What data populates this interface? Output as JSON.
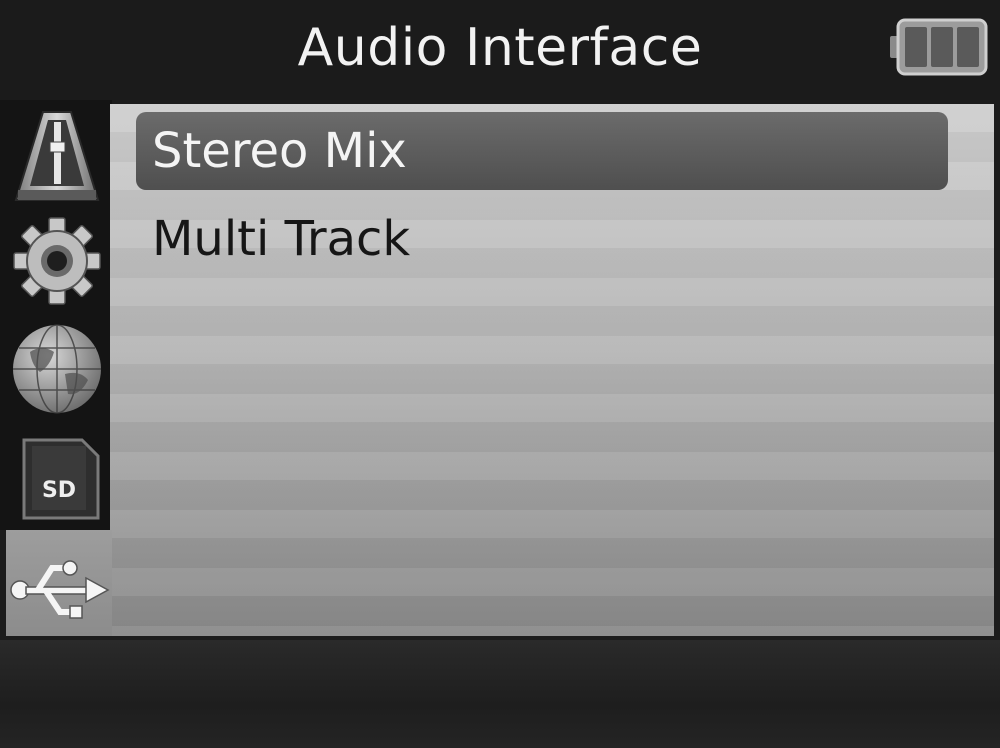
{
  "header": {
    "title": "Audio Interface",
    "battery_icon": "battery-full-icon"
  },
  "sidebar": {
    "items": [
      {
        "icon": "metronome-icon",
        "name": "metronome"
      },
      {
        "icon": "gear-icon",
        "name": "settings"
      },
      {
        "icon": "globe-icon",
        "name": "language"
      },
      {
        "icon": "sd-card-icon",
        "name": "sd-card",
        "label": "SD"
      },
      {
        "icon": "usb-icon",
        "name": "usb",
        "selected": true
      }
    ]
  },
  "menu": {
    "items": [
      {
        "label": "Stereo Mix",
        "selected": true
      },
      {
        "label": "Multi Track",
        "selected": false
      }
    ]
  },
  "colors": {
    "accent_selection": "#5a5a5a",
    "content_background": "#b5b5b5",
    "chrome": "#1b1b1b"
  }
}
